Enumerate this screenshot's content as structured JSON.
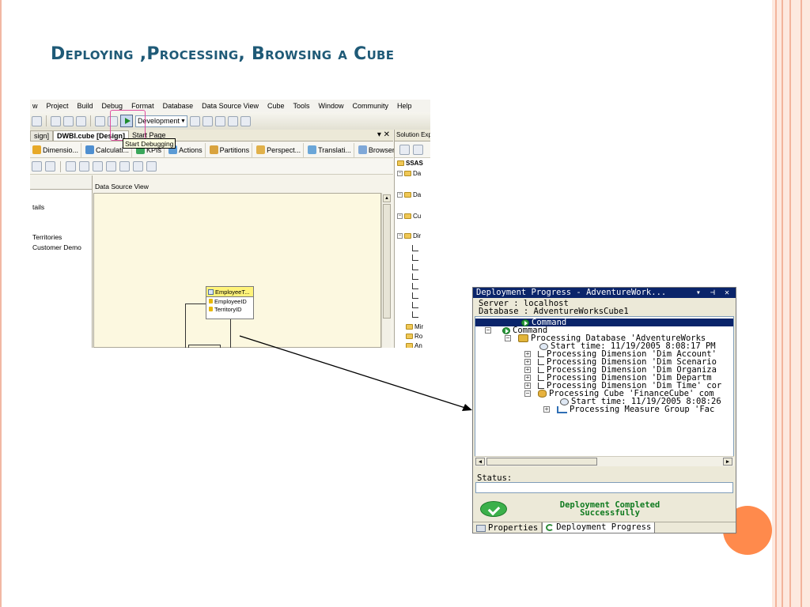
{
  "slide": {
    "title": "Deploying ,Processing, Browsing a Cube"
  },
  "vs": {
    "menu": [
      "w",
      "Project",
      "Build",
      "Debug",
      "Format",
      "Database",
      "Data Source View",
      "Cube",
      "Tools",
      "Window",
      "Community",
      "Help"
    ],
    "config_value": "Development",
    "tooltip": "Start Debugging",
    "doc_tabs": [
      "sign]",
      "DWBI.cube [Design]",
      "Start Page"
    ],
    "doc_controls": "▾ ✕",
    "designer_tabs": [
      "Dimensio...",
      "Calculati...",
      "KPIs",
      "Actions",
      "Partitions",
      "Perspect...",
      "Translati...",
      "Browser"
    ],
    "left_items": [
      "tails",
      "Territories",
      "Customer Demo"
    ],
    "dsv_label": "Data Source View",
    "emp_table": {
      "name": "EmployeeT...",
      "columns": [
        "EmployeeID",
        "TerritoryID"
      ]
    },
    "solution": {
      "header": "Solution Exp",
      "root": "SSAS",
      "nodes": [
        "Da",
        "Da",
        "Cu",
        "Dir",
        "Mir",
        "Ro",
        "An"
      ]
    }
  },
  "deploy": {
    "title": "Deployment Progress - AdventureWork...",
    "title_controls": "▾ ⊣ ✕",
    "server_line": "Server : localhost",
    "database_line": "Database : AdventureWorksCube1",
    "tree": [
      {
        "text": "Command",
        "selected": true
      },
      {
        "text": "Command"
      },
      {
        "text": "Processing Database 'AdventureWorks"
      },
      {
        "text": "Start time: 11/19/2005 8:08:17 PM"
      },
      {
        "text": "Processing Dimension 'Dim Account'"
      },
      {
        "text": "Processing Dimension 'Dim Scenario"
      },
      {
        "text": "Processing Dimension 'Dim Organiza"
      },
      {
        "text": "Processing Dimension 'Dim Departm"
      },
      {
        "text": "Processing Dimension 'Dim Time' cor"
      },
      {
        "text": "Processing Cube 'FinanceCube' com"
      },
      {
        "text": "Start time: 11/19/2005 8:08:26"
      },
      {
        "text": "Processing Measure Group 'Fac"
      }
    ],
    "status_label": "Status:",
    "completed_line1": "Deployment Completed",
    "completed_line2": "Successfully",
    "tabs": [
      "Properties",
      "Deployment Progress"
    ]
  },
  "colors": {
    "title": "#1f5a77",
    "accent_dot": "#ff8a4c",
    "frame": "#f3b49c",
    "selection": "#0a246a",
    "success_text": "#0f7a1f"
  }
}
